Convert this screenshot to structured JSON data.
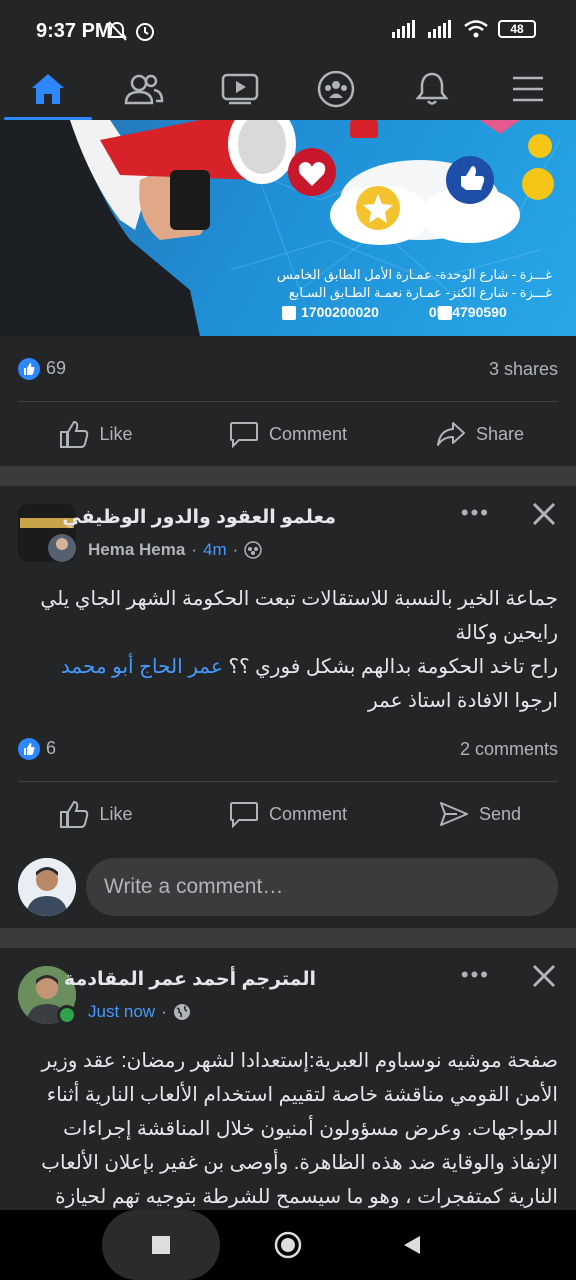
{
  "status": {
    "time": "9:37 PM",
    "battery": "48"
  },
  "nav": {
    "tabs": [
      "home-icon",
      "friends-icon",
      "watch-icon",
      "groups-icon",
      "notifications-icon",
      "menu-icon"
    ],
    "active": "home"
  },
  "banner": {
    "line1": "غـــزة - شارع الوحدة- عمـارة الأمل الطابق الخامس",
    "line2": "غـــزة - شارع الكنز- عمـارة نعمـة الطـابق السـابع",
    "phone1": "1700200020",
    "phone2": "0594790590"
  },
  "post1": {
    "likes": "69",
    "shares": "3 shares",
    "actions": {
      "like": "Like",
      "comment": "Comment",
      "share": "Share"
    }
  },
  "post2": {
    "author": "معلمو العقود والدور الوظيفي",
    "sub_author": "Hema Hema",
    "time": "4m",
    "text_line1": "جماعة الخير بالنسبة للاستقالات تبعت الحكومة الشهر الجاي يلي",
    "text_line2": "رايحين وكالة",
    "text_line3_before": "راح تاخد الحكومة بدالهم بشكل فوري ؟؟ ",
    "mention": "عمر الحاج أبو محمد",
    "text_line4": "ارجوا الافادة استاذ عمر",
    "likes": "6",
    "comments": "2 comments",
    "actions": {
      "like": "Like",
      "comment": "Comment",
      "send": "Send"
    },
    "comment_placeholder": "Write a comment…"
  },
  "post3": {
    "author": "المترجم أحمد عمر المقادمة",
    "time": "Just now",
    "text_line1": "صفحة موشيه نوسباوم العبرية:إستعدادا لشهر رمضان: عقد وزير",
    "text_line2": "الأمن القومي مناقشة خاصة لتقييم استخدام الألعاب النارية أثناء",
    "text_line3": "المواجهات. وعرض مسؤولون أمنيون خلال المناقشة إجراءات",
    "text_line4": "الإنفاذ والوقاية ضد هذه الظاهرة. وأوصى بن غفير بإعلان الألعاب",
    "text_line5": "النارية كمتفجرات ، وهو ما سيسمح للشرطة بتوجيه تهم لحيازة"
  }
}
